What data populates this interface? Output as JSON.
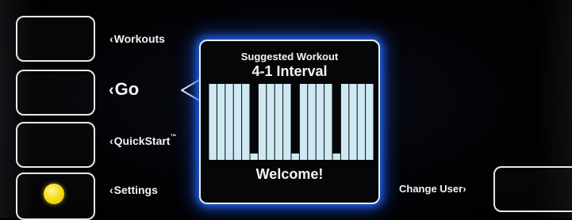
{
  "menu": {
    "workouts": "Workouts",
    "go": "Go",
    "quickstart": "QuickStart",
    "quickstart_mark": "™",
    "settings": "Settings",
    "change_user": "Change User"
  },
  "popup": {
    "title": "Suggested Workout",
    "workout_name": "4-1 Interval",
    "welcome": "Welcome!"
  },
  "profile": {
    "intervals": [
      {
        "level": "high",
        "segments": 5
      },
      {
        "level": "low",
        "segments": 1
      },
      {
        "level": "high",
        "segments": 4
      },
      {
        "level": "low",
        "segments": 1
      },
      {
        "level": "high",
        "segments": 4
      },
      {
        "level": "low",
        "segments": 1
      },
      {
        "level": "high",
        "segments": 4
      }
    ],
    "bar_color": "#cfe9f3"
  },
  "indicator_color": "#f7de1a",
  "glow_color": "#2a6cff"
}
